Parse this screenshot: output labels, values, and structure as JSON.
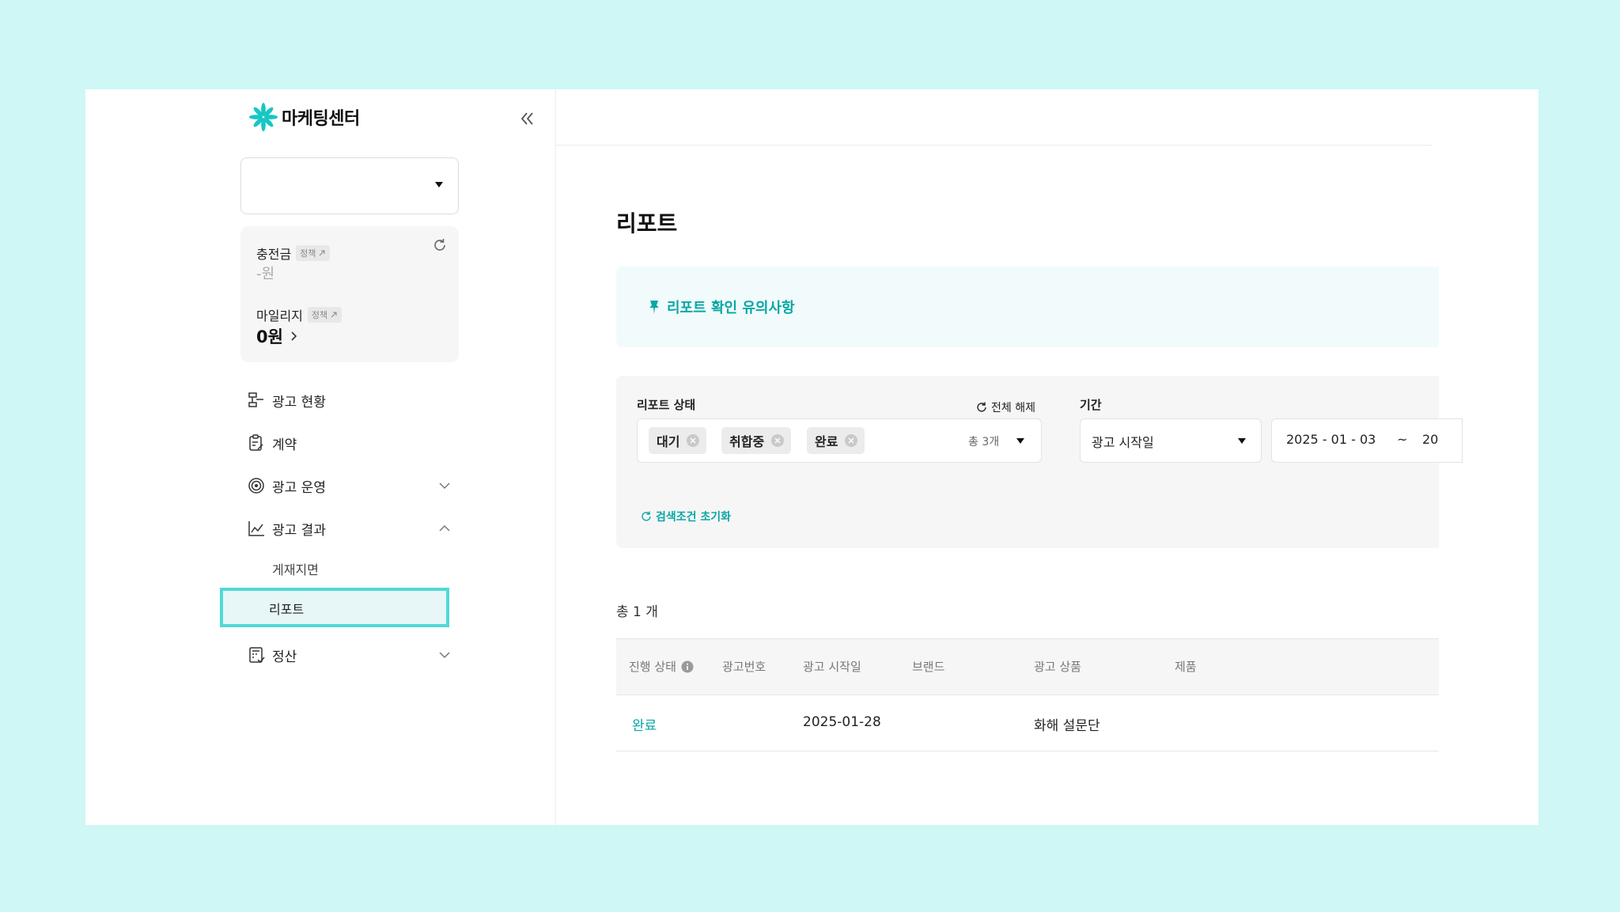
{
  "app": {
    "title": "마케팅센터"
  },
  "wallet": {
    "deposit_label": "충전금",
    "deposit_value": "-원",
    "mileage_label": "마일리지",
    "mileage_value": "0원",
    "policy_label": "정책"
  },
  "nav": {
    "items": [
      {
        "label": "광고 현황",
        "icon": "ad-status-icon"
      },
      {
        "label": "계약",
        "icon": "contract-icon"
      },
      {
        "label": "광고 운영",
        "icon": "target-icon"
      },
      {
        "label": "광고 결과",
        "icon": "chart-line-icon"
      },
      {
        "label": "정산",
        "icon": "settlement-icon"
      }
    ],
    "sub_items": [
      {
        "label": "게재지면"
      },
      {
        "label": "리포트"
      }
    ]
  },
  "page": {
    "title": "리포트",
    "notice": "리포트 확인 유의사항"
  },
  "filters": {
    "status_label": "리포트 상태",
    "clear_all": "전체 해제",
    "chips": [
      "대기",
      "취합중",
      "완료"
    ],
    "total_chip": "총 3개",
    "period_label": "기간",
    "period_value": "광고 시작일",
    "date_start": "2025 - 01 - 03",
    "date_sep": "~",
    "date_end": "20",
    "reset": "검색조건 초기화"
  },
  "results": {
    "count": "총 1 개",
    "columns": [
      "진행 상태",
      "광고번호",
      "광고 시작일",
      "브랜드",
      "광고 상품",
      "제품"
    ],
    "rows": [
      {
        "status": "완료",
        "ad_no": "",
        "start_date": "2025-01-28",
        "brand": "",
        "product_type": "화해 설문단",
        "product": ""
      }
    ]
  },
  "colors": {
    "accent": "#0aa6a6",
    "highlight_border": "#4fd9d8",
    "page_bg": "#cff7f6"
  }
}
